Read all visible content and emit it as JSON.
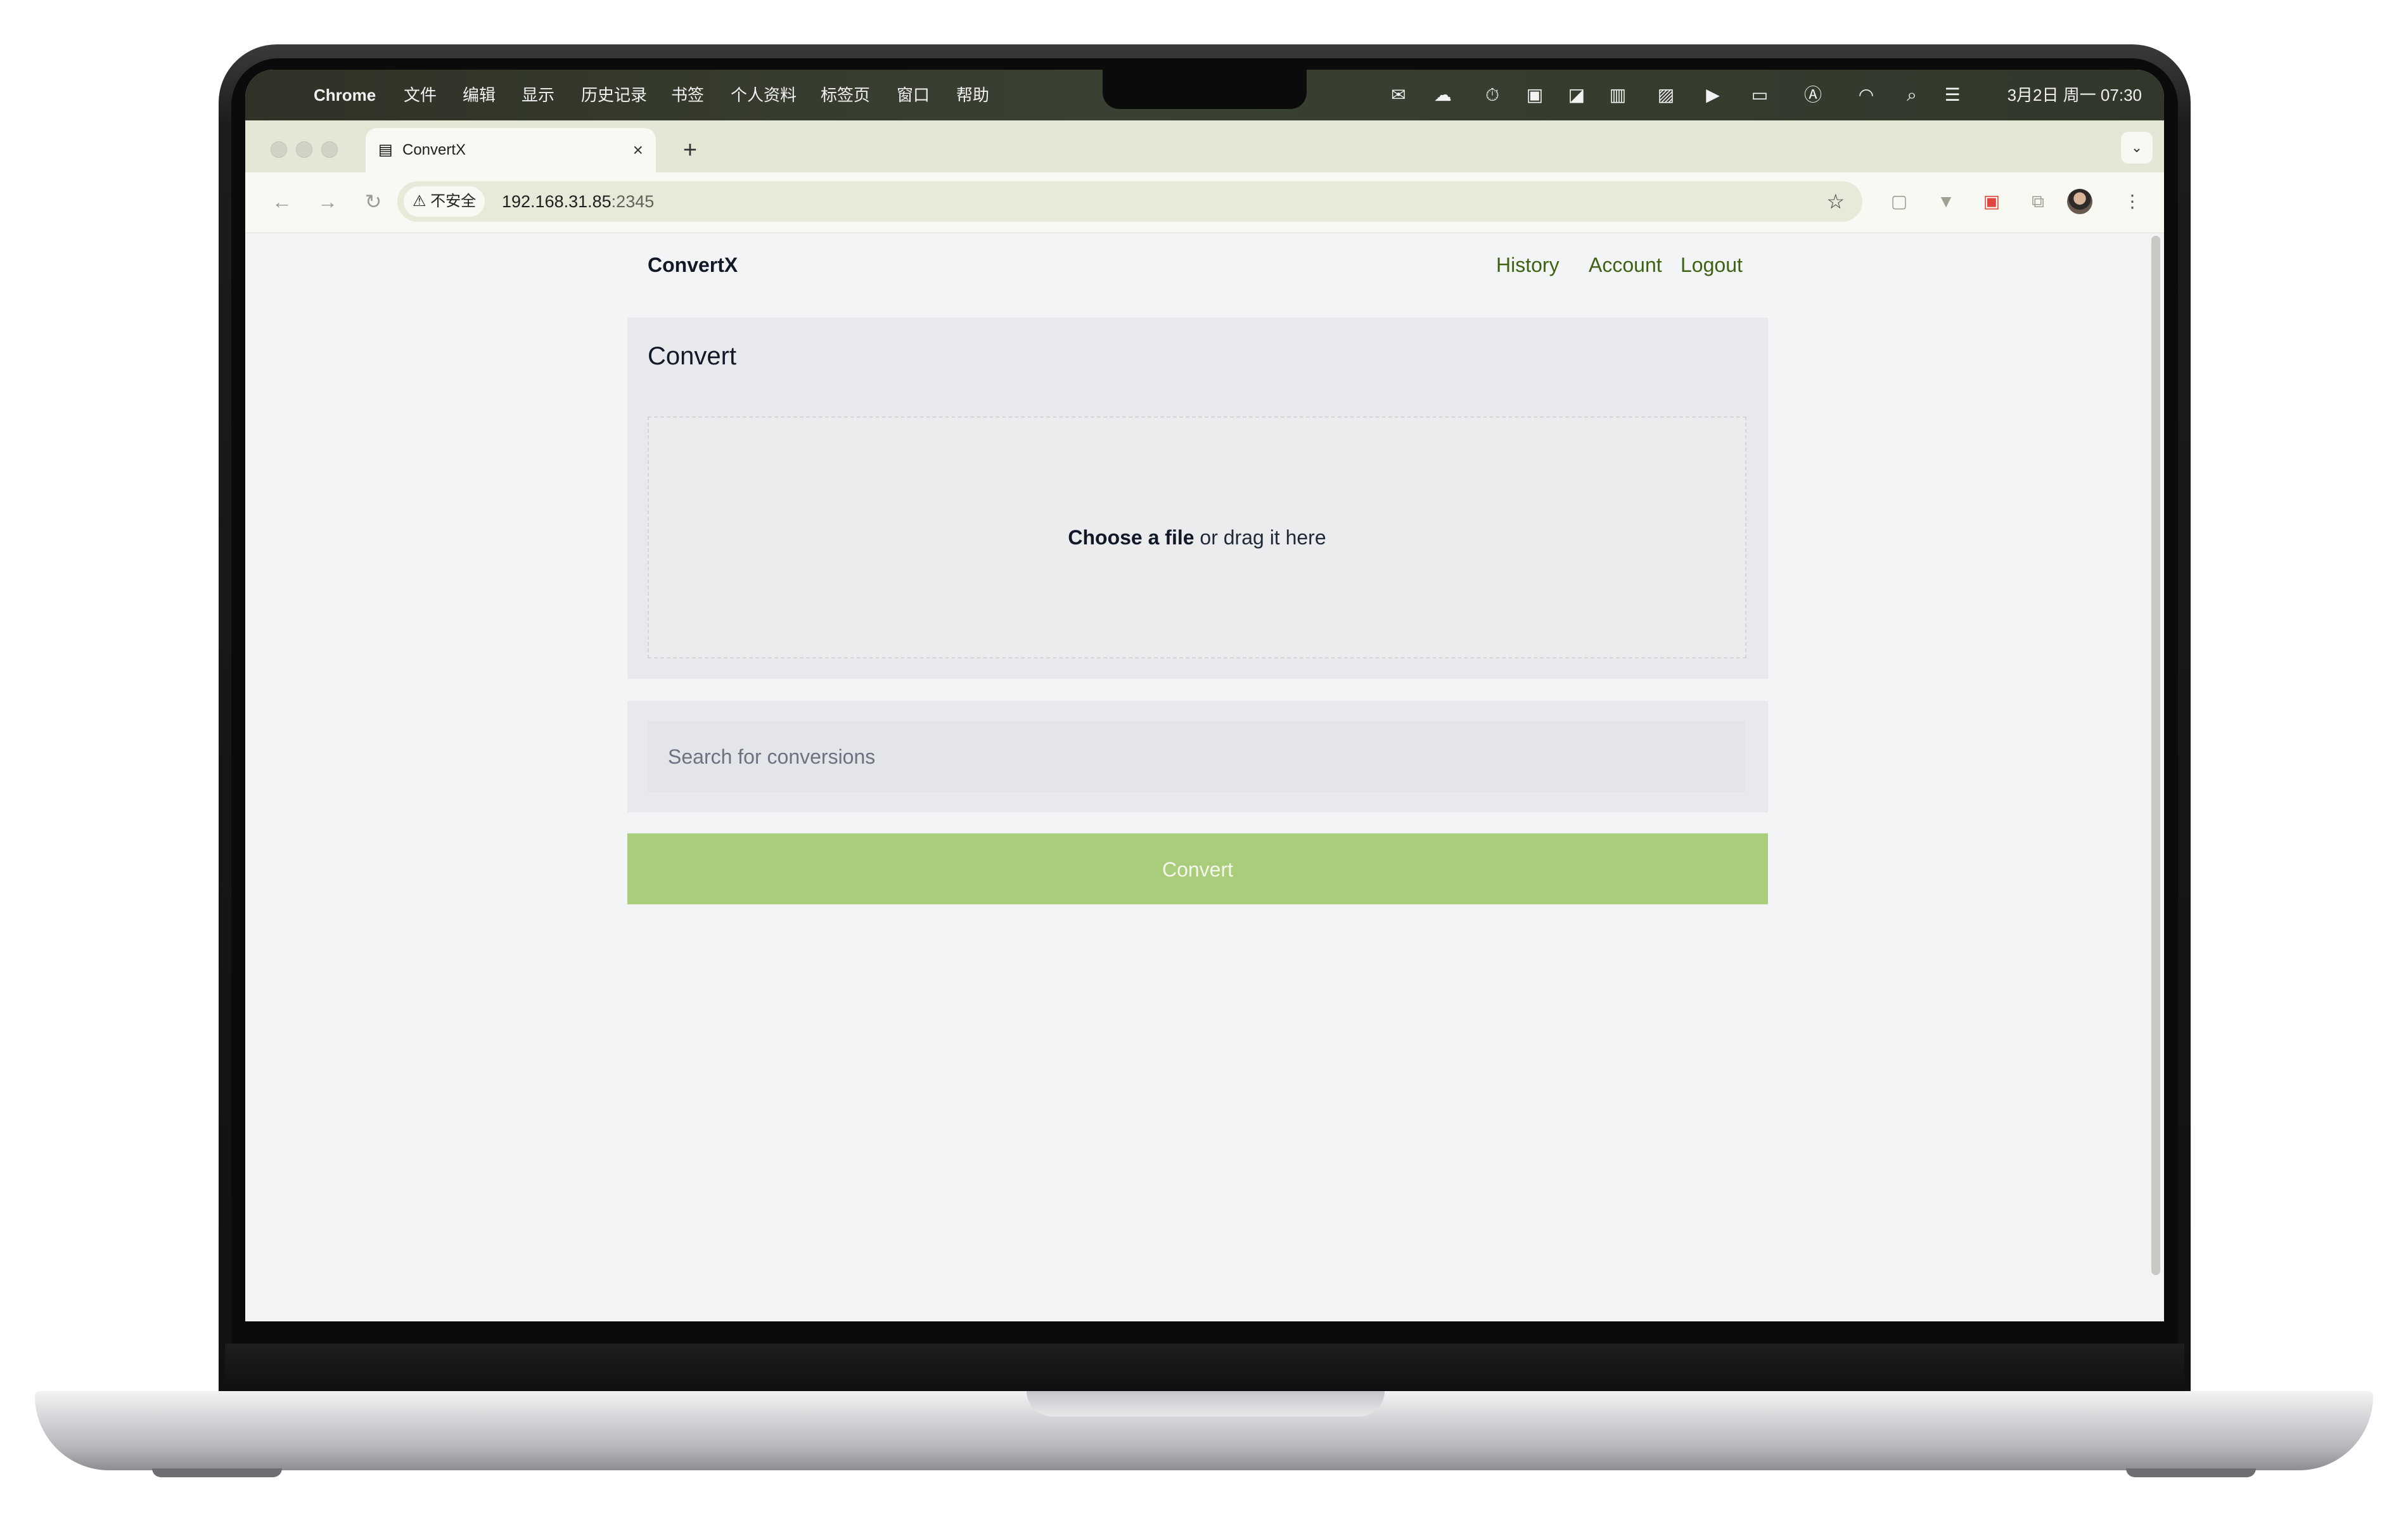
{
  "macos_menubar": {
    "app_name": "Chrome",
    "menu_items": [
      "文件",
      "编辑",
      "显示",
      "历史记录",
      "书签",
      "个人资料",
      "标签页",
      "窗口",
      "帮助"
    ],
    "clock": "3月2日 周一  07:30"
  },
  "browser": {
    "tab_title": "ConvertX",
    "tab_close": "×",
    "new_tab": "+",
    "security_chip": "⚠ 不安全",
    "url_host": "192.168.31.85",
    "url_port": ":2345"
  },
  "page": {
    "brand": "ConvertX",
    "nav": {
      "history": "History",
      "account": "Account",
      "logout": "Logout"
    },
    "convert_card": {
      "heading": "Convert",
      "choose_file": "Choose a file",
      "drag_text": " or drag it here"
    },
    "search": {
      "placeholder": "Search for conversions"
    },
    "convert_button": "Convert"
  },
  "colors": {
    "accent_link": "#3f6212",
    "convert_button_bg": "#aacd7b",
    "page_bg": "#f3f4f6",
    "card_bg": "#e8e9ec"
  }
}
